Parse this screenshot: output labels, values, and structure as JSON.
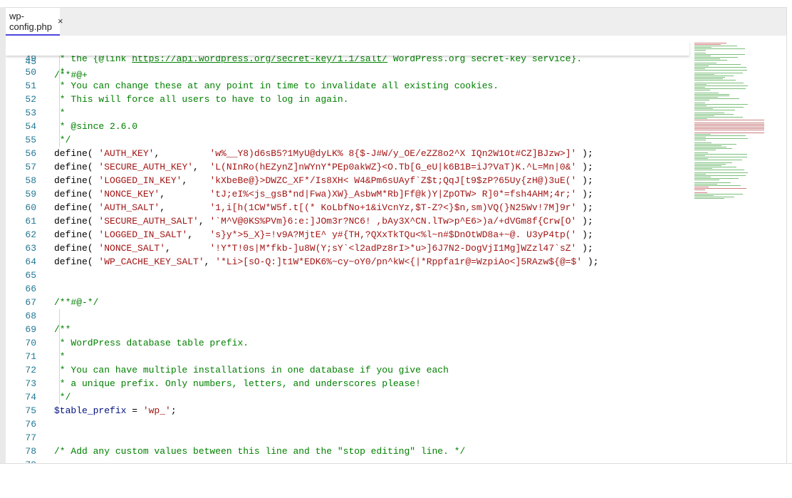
{
  "tab": {
    "filename": "wp-config.php",
    "close_label": "×"
  },
  "sticky_line": {
    "n": "45",
    "parts": [
      {
        "t": "/**#@+",
        "c": "cm"
      }
    ]
  },
  "lines": [
    {
      "n": "49",
      "parts": [
        {
          "t": " * the {@link ",
          "c": "cm"
        },
        {
          "t": "https://api.wordpress.org/secret-key/1.1/salt/",
          "c": "cm link"
        },
        {
          "t": " WordPress.org secret-key service}.",
          "c": "cm"
        }
      ]
    },
    {
      "n": "50",
      "parts": [
        {
          "t": " *",
          "c": "cm"
        }
      ]
    },
    {
      "n": "51",
      "parts": [
        {
          "t": " * You can change these at any point in time to invalidate all existing cookies.",
          "c": "cm"
        }
      ]
    },
    {
      "n": "52",
      "parts": [
        {
          "t": " * This will force all users to have to log in again.",
          "c": "cm"
        }
      ]
    },
    {
      "n": "53",
      "parts": [
        {
          "t": " *",
          "c": "cm"
        }
      ]
    },
    {
      "n": "54",
      "parts": [
        {
          "t": " * @since 2.6.0",
          "c": "cm"
        }
      ]
    },
    {
      "n": "55",
      "parts": [
        {
          "t": " */",
          "c": "cm"
        }
      ]
    },
    {
      "n": "56",
      "parts": [
        {
          "t": "define( ",
          "c": "kw"
        },
        {
          "t": "'AUTH_KEY'",
          "c": "st"
        },
        {
          "t": ",         ",
          "c": "kw"
        },
        {
          "t": "'w%__Y8)d6sB5?1MyU@dyLK% 8{$-J#W/y_OE/eZZ8o2^X IQn2W1Ot#CZ]BJzw>]'",
          "c": "st"
        },
        {
          "t": " );",
          "c": "kw"
        }
      ]
    },
    {
      "n": "57",
      "parts": [
        {
          "t": "define( ",
          "c": "kw"
        },
        {
          "t": "'SECURE_AUTH_KEY'",
          "c": "st"
        },
        {
          "t": ",  ",
          "c": "kw"
        },
        {
          "t": "'L(NInRo(hEZynZ]nWYnY*PEp0akWZ}<O.Tb[G_eU|k6B1B=iJ?VaT)K.^L=Mn|0&'",
          "c": "st"
        },
        {
          "t": " );",
          "c": "kw"
        }
      ]
    },
    {
      "n": "58",
      "parts": [
        {
          "t": "define( ",
          "c": "kw"
        },
        {
          "t": "'LOGGED_IN_KEY'",
          "c": "st"
        },
        {
          "t": ",    ",
          "c": "kw"
        },
        {
          "t": "'kXbeBe@}>DWZC_XF*/Is8XH< W4&Pm6sUAyf`Z$t;QqJ[t9$zP?65Uy{zH@)3uE('",
          "c": "st"
        },
        {
          "t": " );",
          "c": "kw"
        }
      ]
    },
    {
      "n": "59",
      "parts": [
        {
          "t": "define( ",
          "c": "kw"
        },
        {
          "t": "'NONCE_KEY'",
          "c": "st"
        },
        {
          "t": ",        ",
          "c": "kw"
        },
        {
          "t": "'tJ;eI%<js_gsB*nd|Fwa)XW}_AsbwM*Rb]Ff@k)Y|ZpOTW> R]0*=fsh4AHM;4r;'",
          "c": "st"
        },
        {
          "t": " );",
          "c": "kw"
        }
      ]
    },
    {
      "n": "60",
      "parts": [
        {
          "t": "define( ",
          "c": "kw"
        },
        {
          "t": "'AUTH_SALT'",
          "c": "st"
        },
        {
          "t": ",        ",
          "c": "kw"
        },
        {
          "t": "'1,i[h(1CW*W5f.t[(* KoLbfNo+1&iVcnYz,$T-Z?<}$n,sm)VQ(}N25Wv!7M]9r'",
          "c": "st"
        },
        {
          "t": " );",
          "c": "kw"
        }
      ]
    },
    {
      "n": "61",
      "parts": [
        {
          "t": "define( ",
          "c": "kw"
        },
        {
          "t": "'SECURE_AUTH_SALT'",
          "c": "st"
        },
        {
          "t": ", ",
          "c": "kw"
        },
        {
          "t": "'`M^V@0KS%PVm}6:e:]JOm3r?NC6! ,bAy3X^CN.lTw>p^E6>)a/+dVGm8f{Crw[O'",
          "c": "st"
        },
        {
          "t": " );",
          "c": "kw"
        }
      ]
    },
    {
      "n": "62",
      "parts": [
        {
          "t": "define( ",
          "c": "kw"
        },
        {
          "t": "'LOGGED_IN_SALT'",
          "c": "st"
        },
        {
          "t": ",   ",
          "c": "kw"
        },
        {
          "t": "'s}y*>5_X}=!v9A?MjtE^ y#{TH,?QXxTkTQu<%l~n#$DnOtWD8a+~@. U3yP4tp('",
          "c": "st"
        },
        {
          "t": " );",
          "c": "kw"
        }
      ]
    },
    {
      "n": "63",
      "parts": [
        {
          "t": "define( ",
          "c": "kw"
        },
        {
          "t": "'NONCE_SALT'",
          "c": "st"
        },
        {
          "t": ",       ",
          "c": "kw"
        },
        {
          "t": "'!Y*T!0s|M*fkb-]u8W(Y;sY`<l2adPz8rI>*u>]6J7N2-DogVjI1Mg]WZzl47`sZ'",
          "c": "st"
        },
        {
          "t": " );",
          "c": "kw"
        }
      ]
    },
    {
      "n": "64",
      "parts": [
        {
          "t": "define( ",
          "c": "kw"
        },
        {
          "t": "'WP_CACHE_KEY_SALT'",
          "c": "st"
        },
        {
          "t": ", ",
          "c": "kw"
        },
        {
          "t": "'*Li>[sO-Q:]t1W*EDK6%~cy~oY0/pn^kW<{|*Rppfa1r@=WzpiAo<]5RAzw${@=$'",
          "c": "st"
        },
        {
          "t": " );",
          "c": "kw"
        }
      ]
    },
    {
      "n": "65",
      "parts": []
    },
    {
      "n": "66",
      "parts": []
    },
    {
      "n": "67",
      "parts": [
        {
          "t": "/**#@-*/",
          "c": "cm"
        }
      ]
    },
    {
      "n": "68",
      "parts": []
    },
    {
      "n": "69",
      "parts": [
        {
          "t": "/**",
          "c": "cm"
        }
      ]
    },
    {
      "n": "70",
      "parts": [
        {
          "t": " * WordPress database table prefix.",
          "c": "cm"
        }
      ]
    },
    {
      "n": "71",
      "parts": [
        {
          "t": " *",
          "c": "cm"
        }
      ]
    },
    {
      "n": "72",
      "parts": [
        {
          "t": " * You can have multiple installations in one database if you give each",
          "c": "cm"
        }
      ]
    },
    {
      "n": "73",
      "parts": [
        {
          "t": " * a unique prefix. Only numbers, letters, and underscores please!",
          "c": "cm"
        }
      ]
    },
    {
      "n": "74",
      "parts": [
        {
          "t": " */",
          "c": "cm"
        }
      ]
    },
    {
      "n": "75",
      "parts": [
        {
          "t": "$table_prefix",
          "c": "vr"
        },
        {
          "t": " = ",
          "c": "kw"
        },
        {
          "t": "'wp_'",
          "c": "st"
        },
        {
          "t": ";",
          "c": "kw"
        }
      ]
    },
    {
      "n": "76",
      "parts": []
    },
    {
      "n": "77",
      "parts": []
    },
    {
      "n": "78",
      "parts": [
        {
          "t": "/* Add any custom values between this line and the \"stop editing\" line. */",
          "c": "cm"
        }
      ]
    },
    {
      "n": "79",
      "parts": []
    }
  ],
  "colors": {
    "accent": "#4b46e0",
    "comment": "#008000",
    "string": "#a31515",
    "line_number": "#237893"
  }
}
